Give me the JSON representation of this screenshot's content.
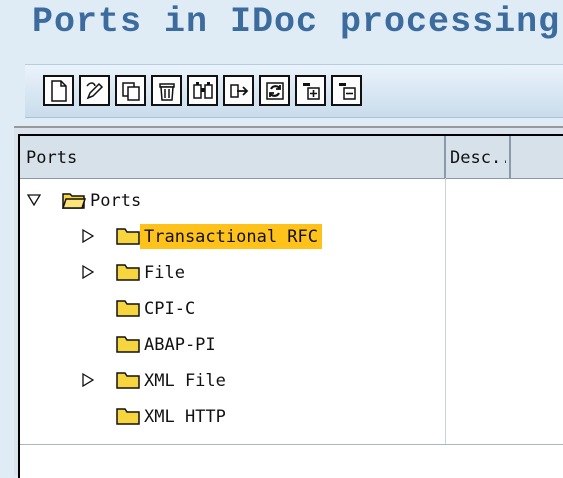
{
  "window": {
    "title": "Ports in IDoc processing"
  },
  "toolbar": {
    "buttons": [
      {
        "name": "create-icon"
      },
      {
        "name": "change-icon"
      },
      {
        "name": "copy-icon"
      },
      {
        "name": "delete-icon"
      },
      {
        "name": "find-icon"
      },
      {
        "name": "transport-icon"
      },
      {
        "name": "refresh-icon"
      },
      {
        "name": "expand-all-icon"
      },
      {
        "name": "collapse-all-icon"
      }
    ]
  },
  "tree": {
    "columns": {
      "name": "Ports",
      "description": "Desc..."
    },
    "root": {
      "label": "Ports",
      "expanded": true
    },
    "items": [
      {
        "label": "Transactional RFC",
        "expandable": true,
        "selected": true
      },
      {
        "label": "File",
        "expandable": true,
        "selected": false
      },
      {
        "label": "CPI-C",
        "expandable": false,
        "selected": false
      },
      {
        "label": "ABAP-PI",
        "expandable": false,
        "selected": false
      },
      {
        "label": "XML File",
        "expandable": true,
        "selected": false
      },
      {
        "label": "XML HTTP",
        "expandable": false,
        "selected": false
      }
    ]
  },
  "colors": {
    "title": "#3c6b9e",
    "selection": "#ffc21a",
    "folder": "#f6d53f"
  }
}
